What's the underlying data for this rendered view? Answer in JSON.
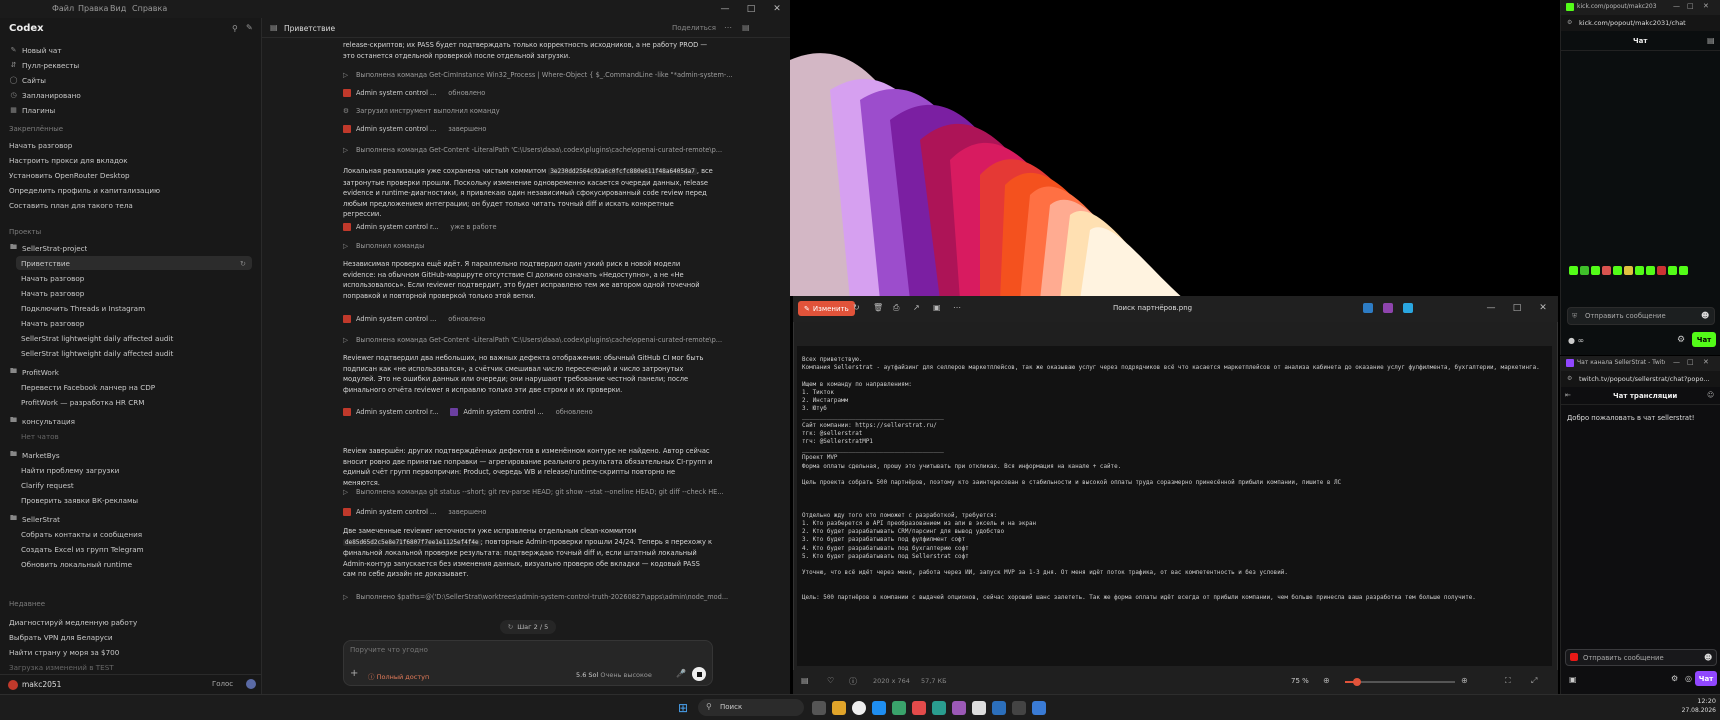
{
  "codex": {
    "app_name": "Codex",
    "menu": [
      "Файл",
      "Правка",
      "Вид",
      "Справка"
    ],
    "nav": [
      {
        "label": "Новый чат",
        "icon": "edit-icon"
      },
      {
        "label": "Пулл-реквесты",
        "icon": "pull-request-icon"
      },
      {
        "label": "Сайты",
        "icon": "globe-icon"
      },
      {
        "label": "Запланировано",
        "icon": "clock-icon"
      },
      {
        "label": "Плагины",
        "icon": "plugin-icon"
      }
    ],
    "pinned_heading": "Закреплённые",
    "pinned": [
      "Начать разговор",
      "Настроить прокси для вкладок",
      "Установить OpenRouter Desktop",
      "Определить профиль и капитализацию",
      "Составить план для такого тела"
    ],
    "projects_heading": "Проекты",
    "projects": [
      {
        "name": "SellerStrat-project",
        "items": [
          "Приветствие",
          "Начать разговор",
          "Начать разговор",
          "Подключить Threads и Instagram",
          "Начать разговор",
          "SellerStrat lightweight daily affected audit",
          "SellerStrat lightweight daily affected audit"
        ]
      },
      {
        "name": "ProfitWork",
        "items": [
          "Перевести Facebook ланчер на CDP",
          "ProfitWork — разработка HR CRM"
        ]
      },
      {
        "name": "консультация",
        "items": [
          "Нет чатов"
        ]
      },
      {
        "name": "MarketBys",
        "items": [
          "Найти проблему загрузки",
          "Clarify request",
          "Проверить заявки ВК-рекламы"
        ]
      },
      {
        "name": "SellerStrat",
        "items": [
          "Собрать контакты и сообщения",
          "Создать Excel из групп Telegram",
          "Обновить локальный runtime"
        ]
      }
    ],
    "recent_heading": "Недавнее",
    "recent": [
      "Диагностируй медленную работу",
      "Выбрать VPN для Беларуси",
      "Найти страну у моря за $700",
      "Загрузка изменений в TEST"
    ],
    "user": "makc2051",
    "voice_label": "Голос",
    "tab_title": "Приветствие",
    "share_label": "Поделиться",
    "messages": {
      "p0": "release-скриптов; их PASS будет подтверждать только корректность исходников, а не работу PROD — это останется отдельной проверкой после отдельной загрузки.",
      "t1": "Выполнена команда Get-CimInstance Win32_Process | Where-Object { $_.CommandLine -like \"*admin-system-...",
      "t2a": "Admin system control ...",
      "t2b": "обновлено",
      "t3": "Загрузил инструмент выполнил команду",
      "t4a": "Admin system control ...",
      "t4b": "завершено",
      "t5": "Выполнена команда Get-Content -LiteralPath 'C:\\Users\\daaa\\.codex\\plugins\\cache\\openai-curated-remote\\p...",
      "p1_pre": "Локальная реализация уже сохранена чистым коммитом",
      "p1_code": "3e230dd2564c02a6c0fcfc880e611f48a6405da7",
      "p1_post": ", все затронутые проверки прошли. Поскольку изменение одновременно касается очереди данных, release evidence и runtime-диагностики, я привлекаю один независимый сфокусированный code review перед любым предложением интеграции; он будет только читать точный diff и искать конкретные регрессии.",
      "t6a": "Admin system control r...",
      "t6b": "уже в работе",
      "t7": "Выполнил команды",
      "p2": "Независимая проверка ещё идёт. Я параллельно подтвердил один узкий риск в новой модели evidence: на обычном GitHub-маршруте отсутствие CI должно означать «Недоступно», а не «Не использовалось». Если reviewer подтвердит, это будет исправлено тем же автором одной точечной поправкой и повторной проверкой только этой ветки.",
      "t8a": "Admin system control ...",
      "t8b": "обновлено",
      "t9": "Выполнена команда Get-Content -LiteralPath 'C:\\Users\\daaa\\.codex\\plugins\\cache\\openai-curated-remote\\p...",
      "p3": "Reviewer подтвердил два небольших, но важных дефекта отображения: обычный GitHub CI мог быть подписан как «не использовался», а счётчик смешивал число пересечений и число затронутых модулей. Это не ошибки данных или очереди; они нарушают требование честной панели; после финального отчёта reviewer я исправлю только эти две строки и их проверки.",
      "t10a": "Admin system control r...",
      "t10b": "Admin system control ...",
      "t10c": "обновлено",
      "p4": "Review завершён: других подтверждённых дефектов в изменённом контуре не найдено. Автор сейчас вносит ровно две принятые поправки — агрегирование реального результата обязательных CI-групп и единый счёт групп первопричин: Product, очередь WB и release/runtime-скрипты повторно не меняются.",
      "t11": "Выполнена команда git status --short; git rev-parse HEAD; git show --stat --oneline HEAD; git diff --check HE...",
      "t12a": "Admin system control ...",
      "t12b": "завершено",
      "p5_pre": "Две замеченные reviewer неточности уже исправлены отдельным clean-коммитом",
      "p5_code": "de85d65d2c5e8e71f6807f7ee1e1125ef4f4e",
      "p5_post": "; повторные Admin-проверки прошли 24/24. Теперь я перехожу к финальной локальной проверке результата: подтверждаю точный diff и, если штатный локальный Admin-контур запускается без изменения данных, визуально проверю обе вкладки — кодовый PASS сам по себе дизайн не доказывает.",
      "t13": "Выполнено $paths=@('D:\\SellerStrat\\worktrees\\admin-system-control-truth-20260827\\apps\\admin\\node_mod..."
    },
    "step_label": "Шаг 2 / 5",
    "composer_placeholder": "Поручите что угодно",
    "access_label": "Полный доступ",
    "model_label": "5.6 Sol",
    "effort_label": "Очень высокое"
  },
  "viewer": {
    "edit_label": "Изменить",
    "file_name": "Поиск партнёров.png",
    "zoom": "75 %",
    "image_dims": "2020 x 764",
    "file_size": "57,7 КБ",
    "text_lines": [
      "Всех приветствую.",
      "Компания Sellerstrat - аутфайзинг для селлеров маркетплейсов, так же оказываю услуг через подрядчиков всё что касается маркетплейсов от анализа кабинета до оказание услуг фулфилмента, бухгалтерии, маркетинга.",
      "",
      "Ищем в команду по направлениям:",
      "1. Тикток",
      "2. Инстаграмм",
      "3. Ютуб",
      "________________________________________",
      "Сайт компании: https://sellerstrat.ru/",
      "тгк: @sellerstrat",
      "тгч: @SellerstratMP1",
      "________________________________________",
      "Проект MVP",
      "Форма оплаты сдельная, прошу это учитывать при откликах. Вся информация на канале + сайте.",
      "",
      "Цель проекта собрать 500 партнёров, поэтому кто заинтересован в стабильности и высокой оплаты труда соразмерно принесённой прибыли компании, пишите в ЛС",
      "",
      "",
      "",
      "Отдельно жду того кто поможет с разработкой, требуется:",
      "1. Кто разберется в API преобразованием из апи в эксель и на экран",
      "2. Кто будет разрабатывать CRM/парсинг для вывод удобство",
      "3. Кто будет разрабатывать под фулфилмент софт",
      "4. Кто будет разрабатывать под бухгалтерию софт",
      "5. Кто будет разрабатывать под Sellerstrat софт",
      "",
      "Уточню, что всё идёт через меня, работа через ИИ, запуск MVP за 1-3 дня. От меня идёт поток трафика, от вас компетентность и без условий.",
      "",
      "",
      "Цель: 500 партнёров в компании с выдачей опционов, сейчас хороший шанс залететь. Так же форма оплаты идёт всегда от прибыли компании, чем больше принесла ваша разработка тем больше получите."
    ]
  },
  "kick": {
    "tab_title": "kick.com/popout/makc2031/...",
    "url": "kick.com/popout/makc2031/chat",
    "header": "Чат",
    "input_placeholder": "Отправить сообщение",
    "chat_button": "Чат"
  },
  "twitch": {
    "tab_title": "Чат канала SellerStrat - Twitch",
    "url": "twitch.tv/popout/sellerstrat/chat?popo...",
    "header": "Чат трансляции",
    "welcome": "Добро пожаловать в чат sellerstrat!",
    "input_placeholder": "Отправить сообщение",
    "chat_button": "Чат"
  },
  "taskbar": {
    "search_placeholder": "Поиск",
    "time": "12:20",
    "date": "27.08.2026"
  },
  "colors": {
    "accent_green": "#53fc18",
    "twitch_purple": "#9147ff",
    "edit_red": "#e1533a"
  }
}
